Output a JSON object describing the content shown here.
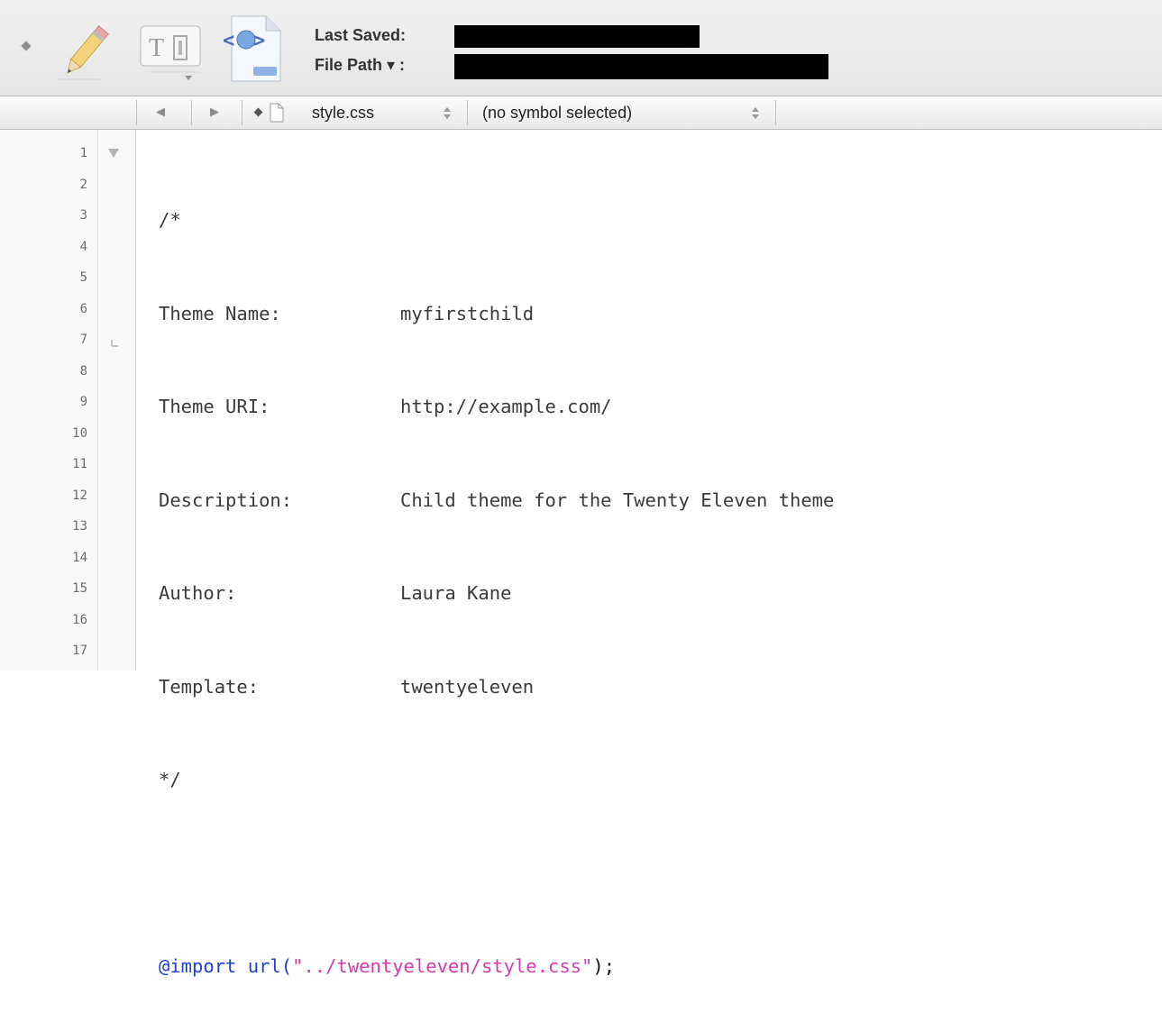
{
  "toolbar": {
    "last_saved_label": "Last Saved:",
    "file_path_label": "File Path ▾ :",
    "last_saved_value": "",
    "file_path_value": "",
    "icons": [
      "bookmark-diamond-icon",
      "pencil-icon",
      "text-document-icon",
      "html-file-icon"
    ]
  },
  "navigator": {
    "file_name": "style.css",
    "symbol": "(no symbol selected)"
  },
  "editor": {
    "line_numbers": [
      "1",
      "2",
      "3",
      "4",
      "5",
      "6",
      "7",
      "8",
      "9",
      "10",
      "11",
      "12",
      "13",
      "14",
      "15",
      "16",
      "17"
    ],
    "lines": {
      "l1": "/*",
      "l2_key": "Theme Name:",
      "l2_val": "myfirstchild",
      "l3_key": "Theme URI:",
      "l3_val": "http://example.com/",
      "l4_key": "Description:",
      "l4_val": "Child theme for the Twenty Eleven theme",
      "l5_key": "Author:",
      "l5_val": "Laura Kane",
      "l6_key": "Template:",
      "l6_val": "twentyeleven",
      "l7": "*/",
      "l9_import": "@import",
      "l9_url": "url(",
      "l9_str": "\"../twentyeleven/style.css\"",
      "l9_end": ");"
    }
  },
  "colors": {
    "keyword": "#1d3fd6",
    "string": "#d93aa8",
    "text": "#3a3a3a"
  }
}
